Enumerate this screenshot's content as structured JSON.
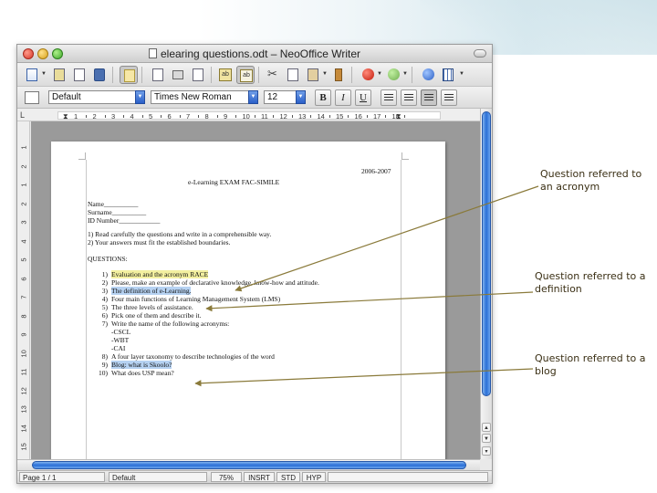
{
  "window": {
    "title": "elearing questions.odt – NeoOffice Writer"
  },
  "format_bar": {
    "paragraph_style": "Default",
    "font_name": "Times New Roman",
    "font_size": "12",
    "bold_label": "B",
    "italic_label": "I",
    "underline_label": "U"
  },
  "ruler": {
    "corner_label": "L",
    "ticks": [
      "1",
      "2",
      "3",
      "4",
      "5",
      "6",
      "7",
      "8",
      "9",
      "10",
      "11",
      "12",
      "13",
      "14",
      "15",
      "16",
      "17",
      "18"
    ],
    "vertical_ticks": [
      "1",
      "2",
      "1",
      "2",
      "3",
      "4",
      "5",
      "6",
      "7",
      "8",
      "9",
      "10",
      "11",
      "12",
      "13",
      "14",
      "15"
    ]
  },
  "document": {
    "year": "2006-2007",
    "title": "e-Learning EXAM FAC-SIMILE",
    "fields": [
      "Name__________",
      "Surname__________",
      "ID Number____________"
    ],
    "instructions": [
      "1) Read carefully the questions and write in a comprehensible way.",
      "2) Your answers must fit the established boundaries."
    ],
    "questions_heading": "QUESTIONS:",
    "questions": [
      {
        "num": "1)",
        "text": "Evaluation and the acronym RACE"
      },
      {
        "num": "2)",
        "text": "Please, make an example of declarative knowledge, know-how and attitude."
      },
      {
        "num": "3)",
        "text": "The definition of e-Learning."
      },
      {
        "num": "4)",
        "text": "Four main functions of Learning Management System (LMS)"
      },
      {
        "num": "5)",
        "text": "The three levels of assistance."
      },
      {
        "num": "6)",
        "text": "Pick one of them and describe it."
      },
      {
        "num": "7)",
        "text": "Write the name of the following acronyms:"
      },
      {
        "num": "",
        "text": "-CSCL"
      },
      {
        "num": "",
        "text": "-WBT"
      },
      {
        "num": "",
        "text": "-CAI"
      },
      {
        "num": "8)",
        "text": "A four layer taxonomy to describe technologies of the word"
      },
      {
        "num": "9)",
        "text": "Blog: what is Skoolo?"
      },
      {
        "num": "10)",
        "text": "What does USP mean?"
      }
    ]
  },
  "status_bar": {
    "page": "Page 1 / 1",
    "style": "Default",
    "zoom": "75%",
    "insert_mode": "INSRT",
    "selection_mode": "STD",
    "hyperlink_mode": "HYP"
  },
  "annotations": {
    "acronym": "Question referred to an acronym",
    "definition": "Question referred to a definition",
    "blog": "Question referred to a blog"
  },
  "colors": {
    "highlight_yellow": "#f3f0a0",
    "highlight_blue": "#b6d2f2",
    "arrow": "#8a7a3a",
    "annotation_text": "#3a2f14"
  }
}
